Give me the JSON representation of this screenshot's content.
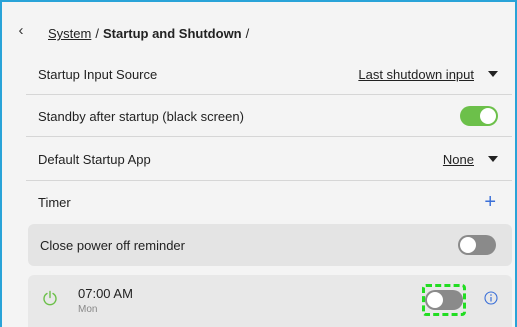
{
  "breadcrumb": {
    "back_icon": "chevron-left-icon",
    "parent": "System",
    "separator": "/",
    "current": "Startup and Shutdown",
    "trailing": "/"
  },
  "settings": {
    "startup_input": {
      "label": "Startup Input Source",
      "value": "Last shutdown input"
    },
    "standby": {
      "label": "Standby after startup (black screen)",
      "enabled": true
    },
    "startup_app": {
      "label": "Default Startup App",
      "value": "None"
    },
    "timer": {
      "label": "Timer",
      "add_icon": "plus-icon"
    }
  },
  "reminder": {
    "label": "Close power off reminder",
    "enabled": false
  },
  "timer_entry": {
    "icon": "power-icon",
    "time": "07:00 AM",
    "days": "Mon",
    "enabled": false,
    "info_icon": "info-icon"
  },
  "colors": {
    "accent_green": "#6cc04a",
    "toggle_off": "#8a8a8a",
    "focus": "#22dd22",
    "frame": "#29a3d8",
    "plus": "#3a6fd8"
  }
}
